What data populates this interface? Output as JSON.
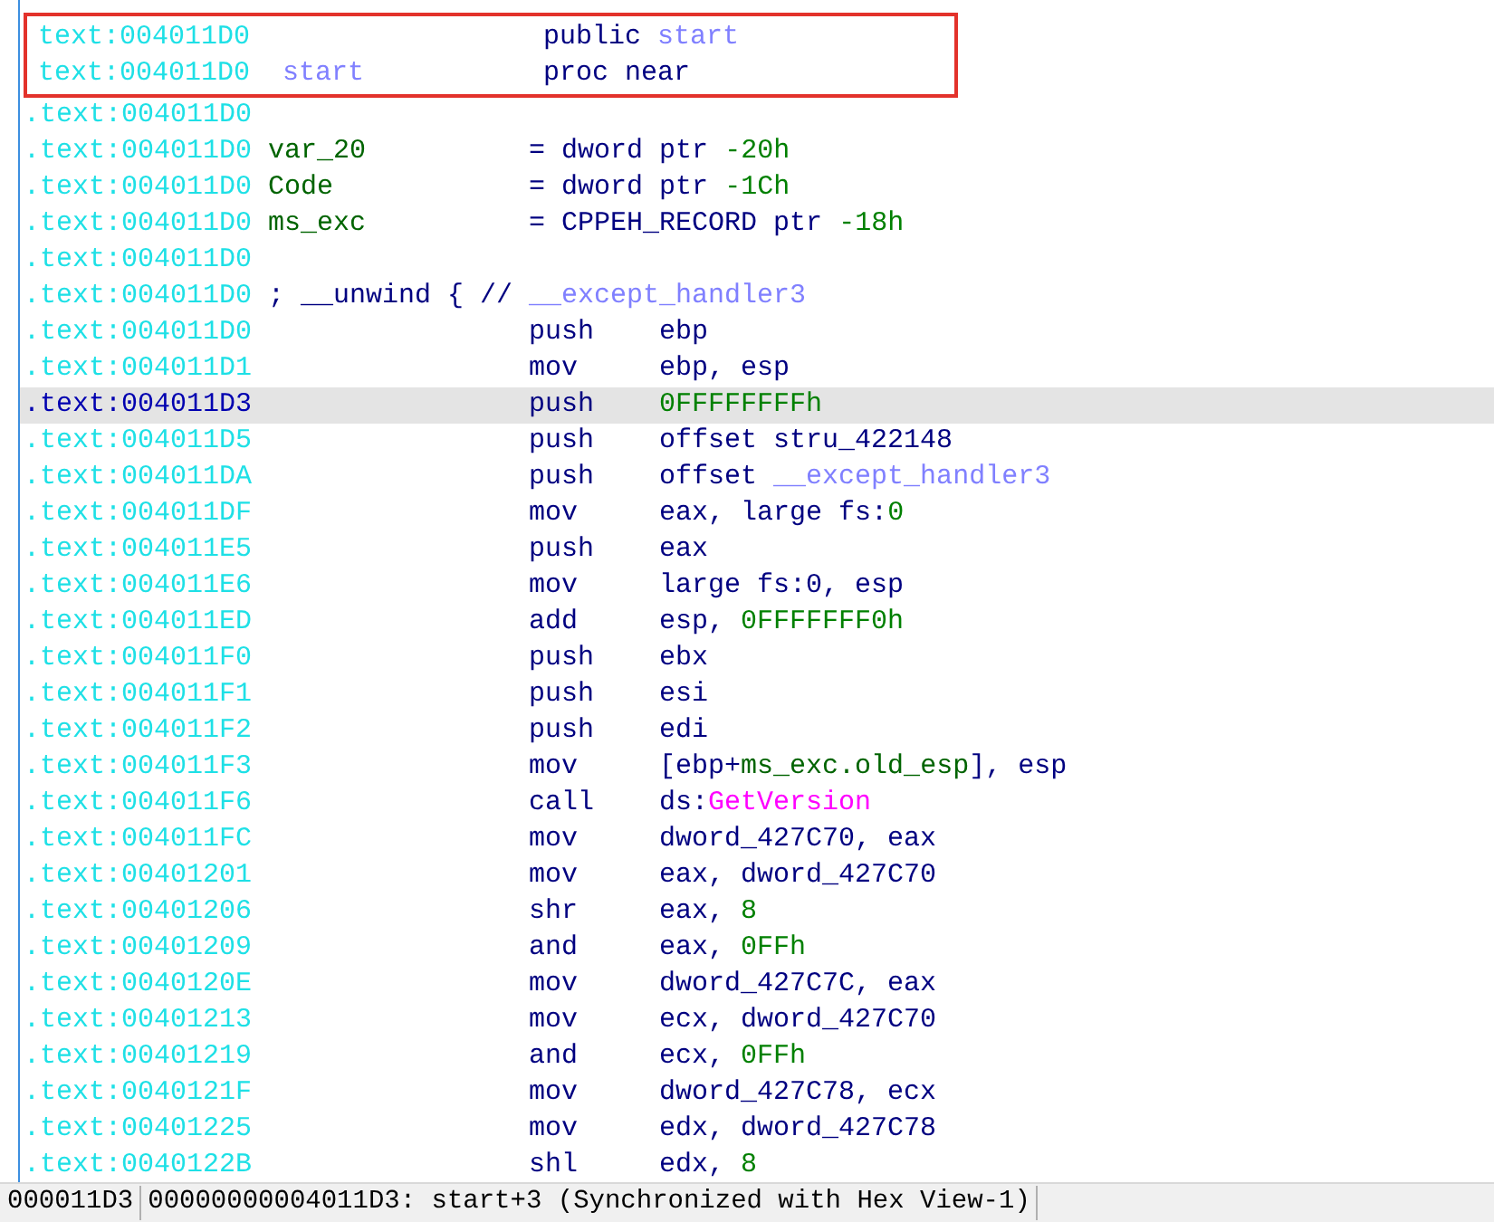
{
  "lines": [
    {
      "kind": "directive",
      "boxed": true,
      "selected": false,
      "address": "text:004011D0",
      "op": [
        {
          "text": "public ",
          "kind": "plain"
        },
        {
          "text": "start",
          "kind": "symbol"
        }
      ]
    },
    {
      "kind": "directive",
      "boxed": true,
      "selected": false,
      "address": "text:004011D0",
      "name": [
        {
          "text": "start",
          "kind": "symbol"
        }
      ],
      "op": [
        {
          "text": "proc near",
          "kind": "plain"
        }
      ]
    },
    {
      "kind": "directive",
      "boxed": false,
      "selected": false,
      "address": ".text:004011D0"
    },
    {
      "kind": "directive",
      "boxed": false,
      "selected": false,
      "address": ".text:004011D0",
      "name": [
        {
          "text": "var_20",
          "kind": "local"
        }
      ],
      "op": [
        {
          "text": "= dword ptr ",
          "kind": "plain"
        },
        {
          "text": "-20h",
          "kind": "number"
        }
      ]
    },
    {
      "kind": "directive",
      "boxed": false,
      "selected": false,
      "address": ".text:004011D0",
      "name": [
        {
          "text": "Code",
          "kind": "local"
        }
      ],
      "op": [
        {
          "text": "= dword ptr ",
          "kind": "plain"
        },
        {
          "text": "-1Ch",
          "kind": "number"
        }
      ]
    },
    {
      "kind": "directive",
      "boxed": false,
      "selected": false,
      "address": ".text:004011D0",
      "name": [
        {
          "text": "ms_exc",
          "kind": "local"
        }
      ],
      "op": [
        {
          "text": "= CPPEH_RECORD ptr ",
          "kind": "plain"
        },
        {
          "text": "-18h",
          "kind": "number"
        }
      ]
    },
    {
      "kind": "directive",
      "boxed": false,
      "selected": false,
      "address": ".text:004011D0"
    },
    {
      "kind": "directive",
      "boxed": false,
      "selected": false,
      "address": ".text:004011D0",
      "name": [
        {
          "text": "; __unwind { //",
          "kind": "plain"
        }
      ],
      "op": [
        {
          "text": "__except_handler3",
          "kind": "symbol"
        }
      ]
    },
    {
      "kind": "code",
      "boxed": false,
      "selected": false,
      "address": ".text:004011D0",
      "op": [
        {
          "text": "push",
          "kind": "plain"
        }
      ],
      "args": [
        {
          "text": "ebp",
          "kind": "plain"
        }
      ]
    },
    {
      "kind": "code",
      "boxed": false,
      "selected": false,
      "address": ".text:004011D1",
      "op": [
        {
          "text": "mov",
          "kind": "plain"
        }
      ],
      "args": [
        {
          "text": "ebp, esp",
          "kind": "plain"
        }
      ]
    },
    {
      "kind": "code",
      "boxed": false,
      "selected": true,
      "address": ".text:004011D3",
      "op": [
        {
          "text": "push",
          "kind": "plain"
        }
      ],
      "args": [
        {
          "text": "0FFFFFFFFh",
          "kind": "number"
        }
      ]
    },
    {
      "kind": "code",
      "boxed": false,
      "selected": false,
      "address": ".text:004011D5",
      "op": [
        {
          "text": "push",
          "kind": "plain"
        }
      ],
      "args": [
        {
          "text": "offset stru_422148",
          "kind": "plain"
        }
      ]
    },
    {
      "kind": "code",
      "boxed": false,
      "selected": false,
      "address": ".text:004011DA",
      "op": [
        {
          "text": "push",
          "kind": "plain"
        }
      ],
      "args": [
        {
          "text": "offset ",
          "kind": "plain"
        },
        {
          "text": "__except_handler3",
          "kind": "symbol"
        }
      ]
    },
    {
      "kind": "code",
      "boxed": false,
      "selected": false,
      "address": ".text:004011DF",
      "op": [
        {
          "text": "mov",
          "kind": "plain"
        }
      ],
      "args": [
        {
          "text": "eax, large fs:",
          "kind": "plain"
        },
        {
          "text": "0",
          "kind": "number"
        }
      ]
    },
    {
      "kind": "code",
      "boxed": false,
      "selected": false,
      "address": ".text:004011E5",
      "op": [
        {
          "text": "push",
          "kind": "plain"
        }
      ],
      "args": [
        {
          "text": "eax",
          "kind": "plain"
        }
      ]
    },
    {
      "kind": "code",
      "boxed": false,
      "selected": false,
      "address": ".text:004011E6",
      "op": [
        {
          "text": "mov",
          "kind": "plain"
        }
      ],
      "args": [
        {
          "text": "large fs:0, esp",
          "kind": "plain"
        }
      ]
    },
    {
      "kind": "code",
      "boxed": false,
      "selected": false,
      "address": ".text:004011ED",
      "op": [
        {
          "text": "add",
          "kind": "plain"
        }
      ],
      "args": [
        {
          "text": "esp, ",
          "kind": "plain"
        },
        {
          "text": "0FFFFFFF0h",
          "kind": "number"
        }
      ]
    },
    {
      "kind": "code",
      "boxed": false,
      "selected": false,
      "address": ".text:004011F0",
      "op": [
        {
          "text": "push",
          "kind": "plain"
        }
      ],
      "args": [
        {
          "text": "ebx",
          "kind": "plain"
        }
      ]
    },
    {
      "kind": "code",
      "boxed": false,
      "selected": false,
      "address": ".text:004011F1",
      "op": [
        {
          "text": "push",
          "kind": "plain"
        }
      ],
      "args": [
        {
          "text": "esi",
          "kind": "plain"
        }
      ]
    },
    {
      "kind": "code",
      "boxed": false,
      "selected": false,
      "address": ".text:004011F2",
      "op": [
        {
          "text": "push",
          "kind": "plain"
        }
      ],
      "args": [
        {
          "text": "edi",
          "kind": "plain"
        }
      ]
    },
    {
      "kind": "code",
      "boxed": false,
      "selected": false,
      "address": ".text:004011F3",
      "op": [
        {
          "text": "mov",
          "kind": "plain"
        }
      ],
      "args": [
        {
          "text": "[ebp+",
          "kind": "plain"
        },
        {
          "text": "ms_exc.old_esp",
          "kind": "local"
        },
        {
          "text": "], esp",
          "kind": "plain"
        }
      ]
    },
    {
      "kind": "code",
      "boxed": false,
      "selected": false,
      "address": ".text:004011F6",
      "op": [
        {
          "text": "call",
          "kind": "plain"
        }
      ],
      "args": [
        {
          "text": "ds:",
          "kind": "plain"
        },
        {
          "text": "GetVersion",
          "kind": "import"
        }
      ]
    },
    {
      "kind": "code",
      "boxed": false,
      "selected": false,
      "address": ".text:004011FC",
      "op": [
        {
          "text": "mov",
          "kind": "plain"
        }
      ],
      "args": [
        {
          "text": "dword_427C70, eax",
          "kind": "plain"
        }
      ]
    },
    {
      "kind": "code",
      "boxed": false,
      "selected": false,
      "address": ".text:00401201",
      "op": [
        {
          "text": "mov",
          "kind": "plain"
        }
      ],
      "args": [
        {
          "text": "eax, dword_427C70",
          "kind": "plain"
        }
      ]
    },
    {
      "kind": "code",
      "boxed": false,
      "selected": false,
      "address": ".text:00401206",
      "op": [
        {
          "text": "shr",
          "kind": "plain"
        }
      ],
      "args": [
        {
          "text": "eax, ",
          "kind": "plain"
        },
        {
          "text": "8",
          "kind": "number"
        }
      ]
    },
    {
      "kind": "code",
      "boxed": false,
      "selected": false,
      "address": ".text:00401209",
      "op": [
        {
          "text": "and",
          "kind": "plain"
        }
      ],
      "args": [
        {
          "text": "eax, ",
          "kind": "plain"
        },
        {
          "text": "0FFh",
          "kind": "number"
        }
      ]
    },
    {
      "kind": "code",
      "boxed": false,
      "selected": false,
      "address": ".text:0040120E",
      "op": [
        {
          "text": "mov",
          "kind": "plain"
        }
      ],
      "args": [
        {
          "text": "dword_427C7C, eax",
          "kind": "plain"
        }
      ]
    },
    {
      "kind": "code",
      "boxed": false,
      "selected": false,
      "address": ".text:00401213",
      "op": [
        {
          "text": "mov",
          "kind": "plain"
        }
      ],
      "args": [
        {
          "text": "ecx, dword_427C70",
          "kind": "plain"
        }
      ]
    },
    {
      "kind": "code",
      "boxed": false,
      "selected": false,
      "address": ".text:00401219",
      "op": [
        {
          "text": "and",
          "kind": "plain"
        }
      ],
      "args": [
        {
          "text": "ecx, ",
          "kind": "plain"
        },
        {
          "text": "0FFh",
          "kind": "number"
        }
      ]
    },
    {
      "kind": "code",
      "boxed": false,
      "selected": false,
      "address": ".text:0040121F",
      "op": [
        {
          "text": "mov",
          "kind": "plain"
        }
      ],
      "args": [
        {
          "text": "dword_427C78, ecx",
          "kind": "plain"
        }
      ]
    },
    {
      "kind": "code",
      "boxed": false,
      "selected": false,
      "address": ".text:00401225",
      "op": [
        {
          "text": "mov",
          "kind": "plain"
        }
      ],
      "args": [
        {
          "text": "edx, dword_427C78",
          "kind": "plain"
        }
      ]
    },
    {
      "kind": "code",
      "boxed": false,
      "selected": false,
      "address": ".text:0040122B",
      "op": [
        {
          "text": "shl",
          "kind": "plain"
        }
      ],
      "args": [
        {
          "text": "edx, ",
          "kind": "plain"
        },
        {
          "text": "8",
          "kind": "number"
        }
      ]
    }
  ],
  "status_bar": [
    "000011D3",
    "00000000004011D3: start+3 (Synchronized with Hex View-1)"
  ]
}
